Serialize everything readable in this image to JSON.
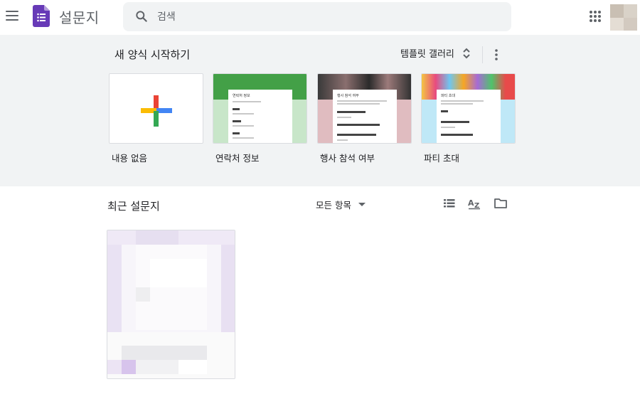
{
  "header": {
    "app_title": "설문지",
    "search": {
      "placeholder": "검색",
      "value": ""
    }
  },
  "gallery": {
    "heading": "새 양식 시작하기",
    "toggle_label": "템플릿 갤러리",
    "templates": [
      {
        "label": "내용 없음"
      },
      {
        "label": "연락처 정보",
        "thumb_title": "연락처 정보"
      },
      {
        "label": "행사 참석 여부",
        "thumb_title": "행사 참석 여부"
      },
      {
        "label": "파티 초대",
        "thumb_title": "파티 초대"
      }
    ]
  },
  "recent": {
    "heading": "최근 설문지",
    "owner_filter": "모든 항목"
  },
  "colors": {
    "brand_purple": "#673ab7",
    "gallery_bg": "#f1f3f4",
    "contact_green": "#43a047",
    "rsvp_pink": "#e0bcc0",
    "party_blue": "#bfe8f7"
  },
  "icons": [
    "menu-icon",
    "forms-logo-icon",
    "search-icon",
    "apps-grid-icon",
    "unfold-icon",
    "more-vert-icon",
    "list-view-icon",
    "sort-az-icon",
    "folder-icon"
  ]
}
